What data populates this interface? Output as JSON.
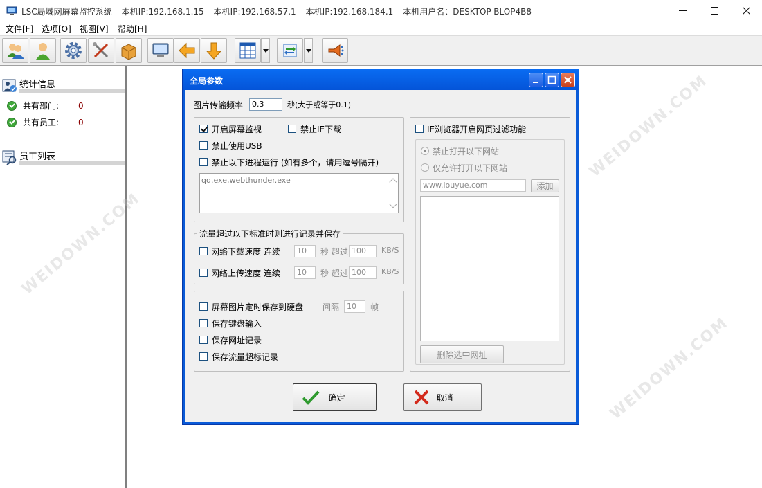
{
  "window": {
    "title_parts": [
      "LSC局域网屏幕监控系统",
      "本机IP:192.168.1.15",
      "本机IP:192.168.57.1",
      "本机IP:192.168.184.1",
      "本机用户名：DESKTOP-BLOP4B8"
    ]
  },
  "menu": [
    "文件[F]",
    "选项[O]",
    "视图[V]",
    "帮助[H]"
  ],
  "toolbar": {
    "buttons": [
      "users-online-icon",
      "user-icon",
      "settings-gear-icon",
      "tools-icon",
      "package-icon",
      "monitor-icon",
      "arrow-left-icon",
      "arrow-down-icon",
      "grid-layout-icon",
      "transfer-icon",
      "broadcast-icon"
    ]
  },
  "sidebar": {
    "stats_title": "统计信息",
    "departments_label": "共有部门:",
    "departments_value": "0",
    "employees_label": "共有员工:",
    "employees_value": "0",
    "employee_list_title": "员工列表"
  },
  "dialog": {
    "title": "全局参数",
    "freq_label": "图片传输频率",
    "freq_value": "0.3",
    "freq_unit": "秒(大于或等于0.1)",
    "enable_monitor": {
      "label": "开启屏幕监视",
      "checked": true
    },
    "block_ie_download": {
      "label": "禁止IE下载",
      "checked": false
    },
    "block_usb": {
      "label": "禁止使用USB",
      "checked": false
    },
    "block_process": {
      "label": "禁止以下进程运行 (如有多个，请用逗号隔开)",
      "checked": false
    },
    "process_list": "qq.exe,webthunder.exe",
    "traffic_group": "流量超过以下标准时则进行记录并保存",
    "download_speed": {
      "label": "网络下载速度 连续",
      "seconds": "10",
      "mid": "秒 超过",
      "limit": "100",
      "unit": "KB/S"
    },
    "upload_speed": {
      "label": "网络上传速度 连续",
      "seconds": "10",
      "mid": "秒 超过",
      "limit": "100",
      "unit": "KB/S"
    },
    "save_screenshots": {
      "label": "屏幕图片定时保存到硬盘",
      "interval_label": "间隔",
      "interval": "10",
      "unit": "帧"
    },
    "save_keyboard": "保存键盘输入",
    "save_urls": "保存网址记录",
    "save_traffic": "保存流量超标记录",
    "ie_filter": {
      "label": "IE浏览器开启网页过滤功能",
      "checked": false
    },
    "block_sites": "禁止打开以下网站",
    "allow_sites": "仅允许打开以下网站",
    "url_input": "www.louyue.com",
    "add_button": "添加",
    "delete_button": "删除选中网址",
    "ok_button": "确定",
    "cancel_button": "取消"
  },
  "watermark": "WEIDOWN.COM"
}
